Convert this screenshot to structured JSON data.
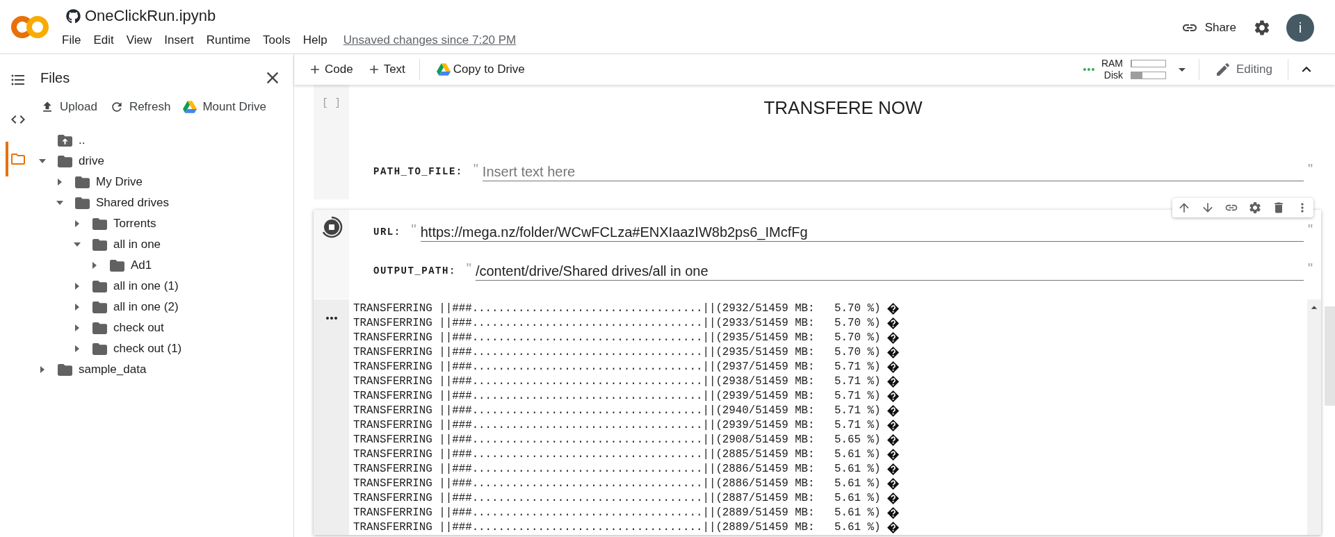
{
  "header": {
    "title": "OneClickRun.ipynb",
    "menu": [
      "File",
      "Edit",
      "View",
      "Insert",
      "Runtime",
      "Tools",
      "Help"
    ],
    "save_status": "Unsaved changes since 7:20 PM",
    "share": "Share",
    "avatar": "i"
  },
  "toolbar": {
    "insert": [
      "Code",
      "Text"
    ],
    "copy": "Copy to Drive",
    "resources": [
      {
        "label": "RAM",
        "level": 0.03
      },
      {
        "label": "Disk",
        "level": 0.33
      }
    ],
    "mode": "Editing"
  },
  "side_rail": [
    {
      "kind": "contents",
      "selected": false
    },
    {
      "kind": "snippets",
      "selected": false
    },
    {
      "kind": "files",
      "selected": true
    }
  ],
  "files_panel": {
    "title": "Files",
    "actions": [
      {
        "kind": "upload",
        "label": "Upload"
      },
      {
        "kind": "refresh",
        "label": "Refresh"
      },
      {
        "kind": "mount",
        "label": "Mount Drive"
      }
    ],
    "tree": [
      {
        "kind": "parent",
        "name": ".."
      },
      {
        "kind": "folder",
        "name": "drive",
        "expanded": true,
        "children": [
          {
            "kind": "folder",
            "name": "My Drive",
            "expanded": false
          },
          {
            "kind": "folder",
            "name": "Shared drives",
            "expanded": true,
            "children": [
              {
                "kind": "folder",
                "name": "Torrents",
                "expanded": false
              },
              {
                "kind": "folder",
                "name": "all in one",
                "expanded": true,
                "children": [
                  {
                    "kind": "folder",
                    "name": "Ad1",
                    "expanded": false
                  }
                ]
              },
              {
                "kind": "folder",
                "name": "all in one (1)",
                "expanded": false
              },
              {
                "kind": "folder",
                "name": "all in one (2)",
                "expanded": false
              },
              {
                "kind": "folder",
                "name": "check out",
                "expanded": false
              },
              {
                "kind": "folder",
                "name": "check out (1)",
                "expanded": false
              }
            ]
          }
        ]
      },
      {
        "kind": "folder",
        "name": "sample_data",
        "expanded": false
      }
    ]
  },
  "cells": [
    {
      "prompt": "[ ]",
      "running": false,
      "focused": false,
      "title": "TRANSFERE NOW",
      "fields": [
        {
          "label": "PATH_TO_FILE:",
          "open_quote": "\"",
          "placeholder": "Insert text here",
          "close_quote": "\""
        }
      ]
    },
    {
      "running": true,
      "focused": true,
      "fields": [
        {
          "label": "URL:",
          "open_quote": "\"",
          "value": "https://mega.nz/folder/WCwFCLza#ENXIaazIW8b2ps6_IMcfFg",
          "close_quote": "\""
        },
        {
          "label": "OUTPUT_PATH:",
          "open_quote": "\"",
          "value": "/content/drive/Shared drives/all in one",
          "close_quote": "\""
        }
      ],
      "output": {
        "lines": [
          "TRANSFERRING ||###...................................||(2932/51459 MB:   5.70 %)",
          "TRANSFERRING ||###...................................||(2933/51459 MB:   5.70 %)",
          "TRANSFERRING ||###...................................||(2935/51459 MB:   5.70 %)",
          "TRANSFERRING ||###...................................||(2935/51459 MB:   5.70 %)",
          "TRANSFERRING ||###...................................||(2937/51459 MB:   5.71 %)",
          "TRANSFERRING ||###...................................||(2938/51459 MB:   5.71 %)",
          "TRANSFERRING ||###...................................||(2939/51459 MB:   5.71 %)",
          "TRANSFERRING ||###...................................||(2940/51459 MB:   5.71 %)",
          "TRANSFERRING ||###...................................||(2939/51459 MB:   5.71 %)",
          "TRANSFERRING ||###...................................||(2908/51459 MB:   5.65 %)",
          "TRANSFERRING ||###...................................||(2885/51459 MB:   5.61 %)",
          "TRANSFERRING ||###...................................||(2886/51459 MB:   5.61 %)",
          "TRANSFERRING ||###...................................||(2886/51459 MB:   5.61 %)",
          "TRANSFERRING ||###...................................||(2887/51459 MB:   5.61 %)",
          "TRANSFERRING ||###...................................||(2889/51459 MB:   5.61 %)",
          "TRANSFERRING ||###...................................||(2889/51459 MB:   5.61 %)"
        ]
      }
    }
  ]
}
